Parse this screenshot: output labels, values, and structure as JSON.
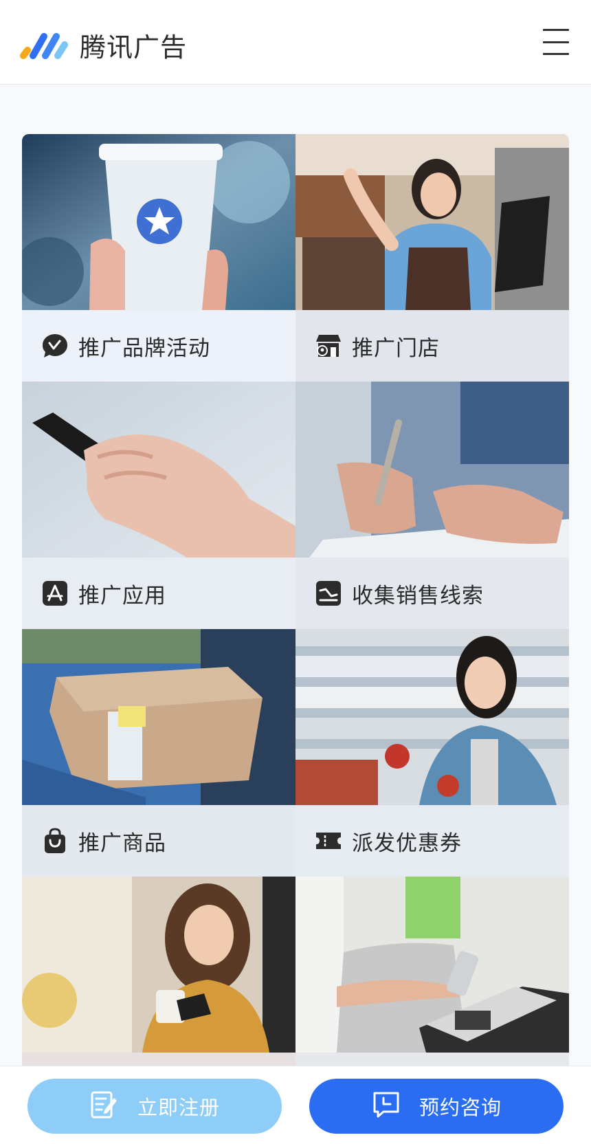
{
  "header": {
    "brand": "腾讯广告",
    "logo_icon": "tencent-ads-logo",
    "menu_icon": "hamburger-menu-icon"
  },
  "cards": [
    {
      "label": "推广品牌活动",
      "icon": "brand-bubble-icon",
      "photo": "coffee-cup-photo"
    },
    {
      "label": "推广门店",
      "icon": "store-location-icon",
      "photo": "barista-photo"
    },
    {
      "label": "推广应用",
      "icon": "app-store-icon",
      "photo": "phone-hands-photo"
    },
    {
      "label": "收集销售线索",
      "icon": "leads-chart-icon",
      "photo": "pen-signing-photo"
    },
    {
      "label": "推广商品",
      "icon": "shopping-bag-icon",
      "photo": "package-delivery-photo"
    },
    {
      "label": "派发优惠券",
      "icon": "coupon-icon",
      "photo": "supermarket-photo"
    },
    {
      "label": "",
      "icon": "",
      "photo": "woman-coffee-phone-photo"
    },
    {
      "label": "",
      "icon": "",
      "photo": "payment-terminal-photo"
    }
  ],
  "bottom": {
    "register_label": "立即注册",
    "consult_label": "预约咨询"
  },
  "colors": {
    "register_bg": "#8ecdf8",
    "consult_bg": "#2a6df2",
    "logo_blue": "#2f6ff0",
    "logo_orange": "#f7a81b",
    "logo_light": "#7cc6f6"
  }
}
